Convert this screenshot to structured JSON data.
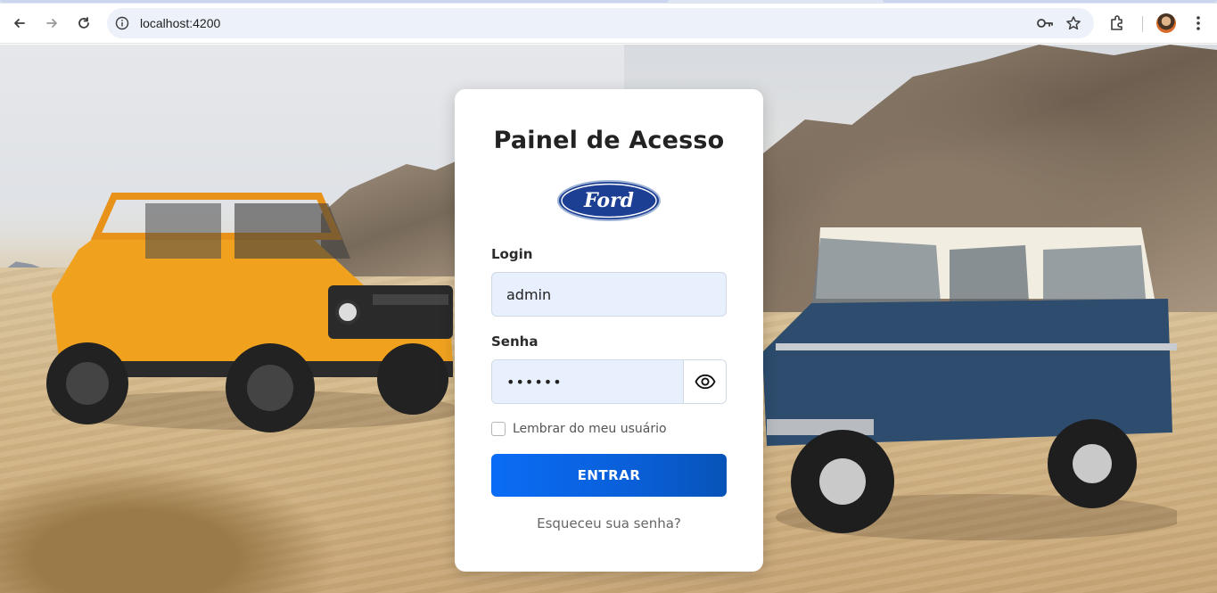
{
  "browser": {
    "url": "localhost:4200"
  },
  "login_card": {
    "title": "Painel de Acesso",
    "logo_text": "Ford",
    "login_label": "Login",
    "login_value": "admin",
    "password_label": "Senha",
    "password_value": "••••••",
    "remember_label": "Lembrar do meu usuário",
    "remember_checked": false,
    "submit_label": "ENTRAR",
    "forgot_link": "Esqueceu sua senha?"
  },
  "colors": {
    "accent": "#0a6cf5",
    "input_bg": "#e8f0fe",
    "ford_blue": "#1c3f94"
  },
  "icons": [
    "back-icon",
    "forward-icon",
    "reload-icon",
    "site-info-icon",
    "password-key-icon",
    "bookmark-star-icon",
    "extensions-icon",
    "profile-avatar",
    "kebab-menu-icon",
    "eye-icon"
  ]
}
